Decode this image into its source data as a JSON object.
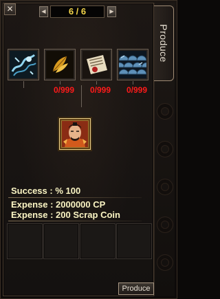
{
  "window": {
    "close_icon": "close-icon"
  },
  "pager": {
    "current": "6 / 6",
    "prev_icon": "chevron-left-icon",
    "next_icon": "chevron-right-icon"
  },
  "side_tab": {
    "label": "Produce"
  },
  "ingredients": [
    {
      "name": "dragon-essence-icon",
      "count": ""
    },
    {
      "name": "golden-feather-icon",
      "count": "0/999"
    },
    {
      "name": "recipe-scroll-icon",
      "count": "0/999"
    },
    {
      "name": "blue-scales-icon",
      "count": "0/999"
    }
  ],
  "result": {
    "icon": "warrior-portrait-icon"
  },
  "info": {
    "success": "Success : % 100",
    "expense_cp": "Expense : 2000000 CP",
    "expense_coin": "Expense : 200 Scrap Coin"
  },
  "actions": {
    "produce_label": "Produce"
  },
  "colors": {
    "count_red": "#ff1a1a",
    "page_yellow": "#f2d44a",
    "info_text": "#fbf5c4"
  }
}
